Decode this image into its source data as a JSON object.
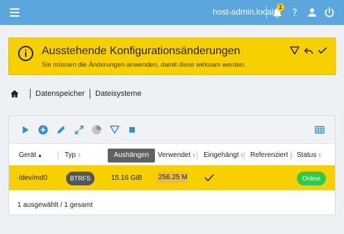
{
  "header": {
    "hostname": "host-admin.local",
    "notification_count": "1"
  },
  "banner": {
    "title": "Ausstehende Konfigurationsänderungen",
    "message": "Sie müssen die Änderungen anwenden, damit diese wirksam werden."
  },
  "breadcrumb": [
    "Datenspeicher",
    "Dateisysteme"
  ],
  "table": {
    "columns": [
      "Gerät",
      "Typ",
      "Verwendet",
      "Eingehängt",
      "Referenziert",
      "Status"
    ],
    "tooltip": "Aushängen",
    "rows": [
      {
        "device": "/dev/md0",
        "type": "BTRFS",
        "size": "15.16 GiB",
        "used": "256.25 M",
        "mounted": true,
        "status": "Online"
      }
    ],
    "footer": "1 ausgewählt / 1 gesamt"
  },
  "colors": {
    "topbar": "#5aa6dd",
    "banner": "#f8d000",
    "selected_row": "#f8d000",
    "status_online": "#32c84e",
    "toolbar_icon": "#2f8fd4"
  },
  "icons": {
    "topbar": [
      "menu-icon",
      "bell-icon",
      "help-icon",
      "user-icon",
      "power-icon"
    ],
    "banner": [
      "info-icon",
      "filter-icon",
      "undo-icon",
      "check-icon"
    ],
    "toolbar": [
      "play-icon",
      "add-circle-icon",
      "edit-icon",
      "expand-icon",
      "pie-chart-icon",
      "filter-icon",
      "stop-icon",
      "table-icon"
    ]
  }
}
